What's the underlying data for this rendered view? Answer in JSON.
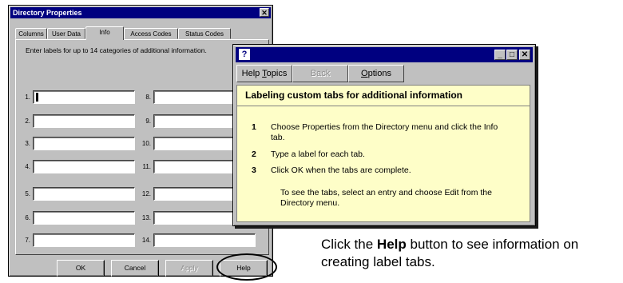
{
  "dialog": {
    "title": "Directory Properties",
    "close": "✕",
    "tabs": [
      "Columns",
      "User Data",
      "Info",
      "Access Codes",
      "Status Codes"
    ],
    "instruction": "Enter labels for up to 14 categories of additional information.",
    "rows_left": [
      "1.",
      "2.",
      "3.",
      "4.",
      "5.",
      "6.",
      "7."
    ],
    "rows_right": [
      "8.",
      "9.",
      "10.",
      "11.",
      "12.",
      "13.",
      "14."
    ],
    "buttons": {
      "ok": "OK",
      "cancel": "Cancel",
      "apply": "Apply",
      "help": "Help"
    }
  },
  "help_window": {
    "icon": "?",
    "minimize": "_",
    "maximize": "□",
    "close": "✕",
    "toolbar": {
      "topics_pre": "Help ",
      "topics_key": "T",
      "topics_post": "opics",
      "back": "Back",
      "options_key": "O",
      "options_post": "ptions"
    },
    "topic_title": "Labeling custom tabs for additional information",
    "steps": [
      {
        "num": "1",
        "text": "Choose Properties from the Directory menu and click the Info tab."
      },
      {
        "num": "2",
        "text": "Type a label for each tab."
      },
      {
        "num": "3",
        "text": "Click OK when the tabs are complete."
      }
    ],
    "note": "To see the tabs, select an entry and choose Edit from the Directory menu."
  },
  "caption": {
    "part1": "Click the ",
    "bold": "Help",
    "part2": " button to see information on creating label tabs."
  }
}
